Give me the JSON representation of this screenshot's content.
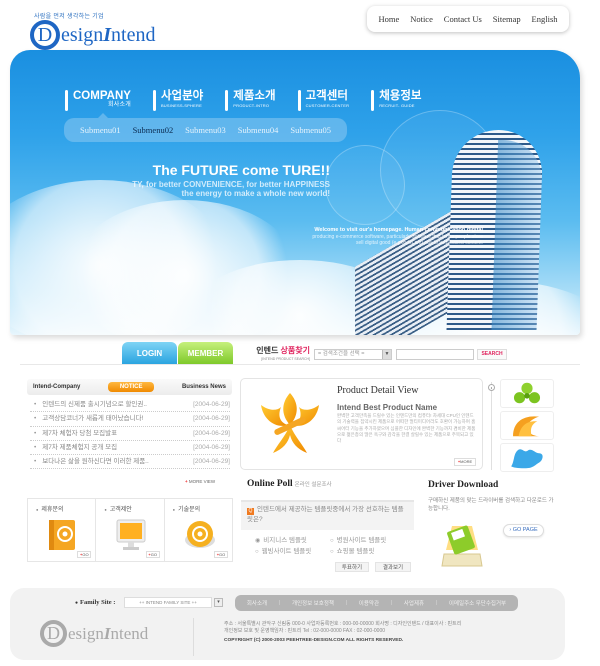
{
  "header": {
    "tagline": "사람을 먼저 생각하는 기업",
    "logo_initial": "D",
    "logo_text": "esign",
    "logo_text2": "ntend",
    "logo_italic": "I",
    "top_nav": [
      "Home",
      "Notice",
      "Contact Us",
      "Sitemap",
      "English"
    ]
  },
  "main_nav": [
    {
      "label": "COMPANY",
      "sub": "회사소개"
    },
    {
      "label": "사업분야",
      "sub": "BUSINESS-SPHERE"
    },
    {
      "label": "제품소개",
      "sub": "PRODUCT-INTRO"
    },
    {
      "label": "고객센터",
      "sub": "CUSTOMER-CENTER"
    },
    {
      "label": "채용정보",
      "sub": "RECRUIT- GUIDE"
    }
  ],
  "submenu": {
    "items": [
      "Submenu01",
      "Submenu02",
      "Submenu03",
      "Submenu04",
      "Submenu05"
    ],
    "active_index": 1
  },
  "hero": {
    "title": "The FUTURE come TURE!!",
    "line1": "TY, for better CONVENIENCE, for better  HAPPINESS",
    "line2": "the energy to make a whole new world!",
    "welcome": "Welcome to visit our's homepage. Human communication digital",
    "welcome2": "producing e-commerce software, particularly software that helps people store",
    "welcome3": "sell digital good (e-goods) and pay to web-based content."
  },
  "login": {
    "login_label": "LOGIN",
    "member_label": "MEMBER"
  },
  "search": {
    "label_prefix": "인텐드 ",
    "label_highlight": "상품찾기",
    "label_sub": "[INTEND PRODUCT SEARCH]",
    "select_value": "= 검색조건을 선택 =",
    "input_value": "",
    "button_label": "SEARCH"
  },
  "notice": {
    "tabs": [
      "Intend-Company",
      "NOTICE",
      "Business News"
    ],
    "active_tab": 1,
    "rows": [
      {
        "title": "인텐드의 신제품 출시기념으로 할인권..",
        "date": "[2004-06-29]"
      },
      {
        "title": "고객상담코너가 새롭게 태어났습니다!",
        "date": "[2004-06-29]"
      },
      {
        "title": "제7차 체험자 당첨 모집발표",
        "date": "[2004-06-29]"
      },
      {
        "title": "제7차 제품체험지 공개 모집",
        "date": "[2004-06-29]"
      },
      {
        "title": "보다나은 삶을 원하신다면 이러한 제품..",
        "date": "[2004-06-29]"
      }
    ],
    "more_label": "MORE VIEW"
  },
  "product": {
    "title": "Product Detail View",
    "name": "Intend Best Product Name",
    "description": "완벽한 고객만족을 드릴수 있는 인텐드만의 컴퓨터! 차세대 CPU인 인텐드의 기술력을 집약시킨 제품으로 어떠한 멀티미디어라도 호환이 가능하며 홈씨어터 기능을 추가하였으며 심플한 디자인에 완벽한 기능까지 겸비한 제품으로 젊은층의 많은 욕구와 감각을 한결 살릴수 있는 제품으로 주목되고 있다",
    "more_label": "MORE"
  },
  "thumbs": [
    "green-clover-icon",
    "orange-wave-icon",
    "blue-splash-icon"
  ],
  "inquiries": [
    {
      "label": "제휴문의",
      "go": "GO",
      "icon": "address-book-icon"
    },
    {
      "label": "고객제안",
      "go": "GO",
      "icon": "monitor-icon"
    },
    {
      "label": "기술문의",
      "go": "GO",
      "icon": "email-at-icon"
    }
  ],
  "poll": {
    "title": "Online Poll",
    "subtitle": "온라인 설문조사",
    "question": "인텐드에서 제공하는 템플릿중에서 가장 선호하는 템플릿은?",
    "options": [
      "비지니스 템플릿",
      "병원사이트 템플릿",
      "웹빙사이트 템플릿",
      "쇼핑몰 템플릿"
    ],
    "selected_index": 0,
    "vote_label": "투표하기",
    "result_label": "결과보기"
  },
  "driver": {
    "title": "Driver Download",
    "description": "구매하신 제품의 맞는 드라이버를 검색하고 다운로드 가능합니다.",
    "button_label": "GO PAGE"
  },
  "footer": {
    "family_label": "Family Site :",
    "family_value": "++ INTEND FAMILY SITE ++",
    "links": [
      "회사소개",
      "개인정보 보호정책",
      "이용약관",
      "사업제휴",
      "이메일주소 무단수집거부"
    ],
    "address1": "주소 : 서울특별시 관악구 신림동 000-0  사업자등록번호 : 000-00-00000 회사명 : 디자인인텐드  / 대표이사 : 핀트리",
    "address2": "개인정보 보호 및 운영책임자 :  핀트리   Tel : 02-000-0000  FAX : 02-000-0000",
    "copyright": "COPYRIGHT (C) 2000-2003 PEEHTREE-DESIGN.COM  ALL RIGHTS RESERVED."
  },
  "colors": {
    "brand_blue": "#1e66c4",
    "accent_orange": "#f08a00",
    "accent_pink": "#e0245e"
  }
}
